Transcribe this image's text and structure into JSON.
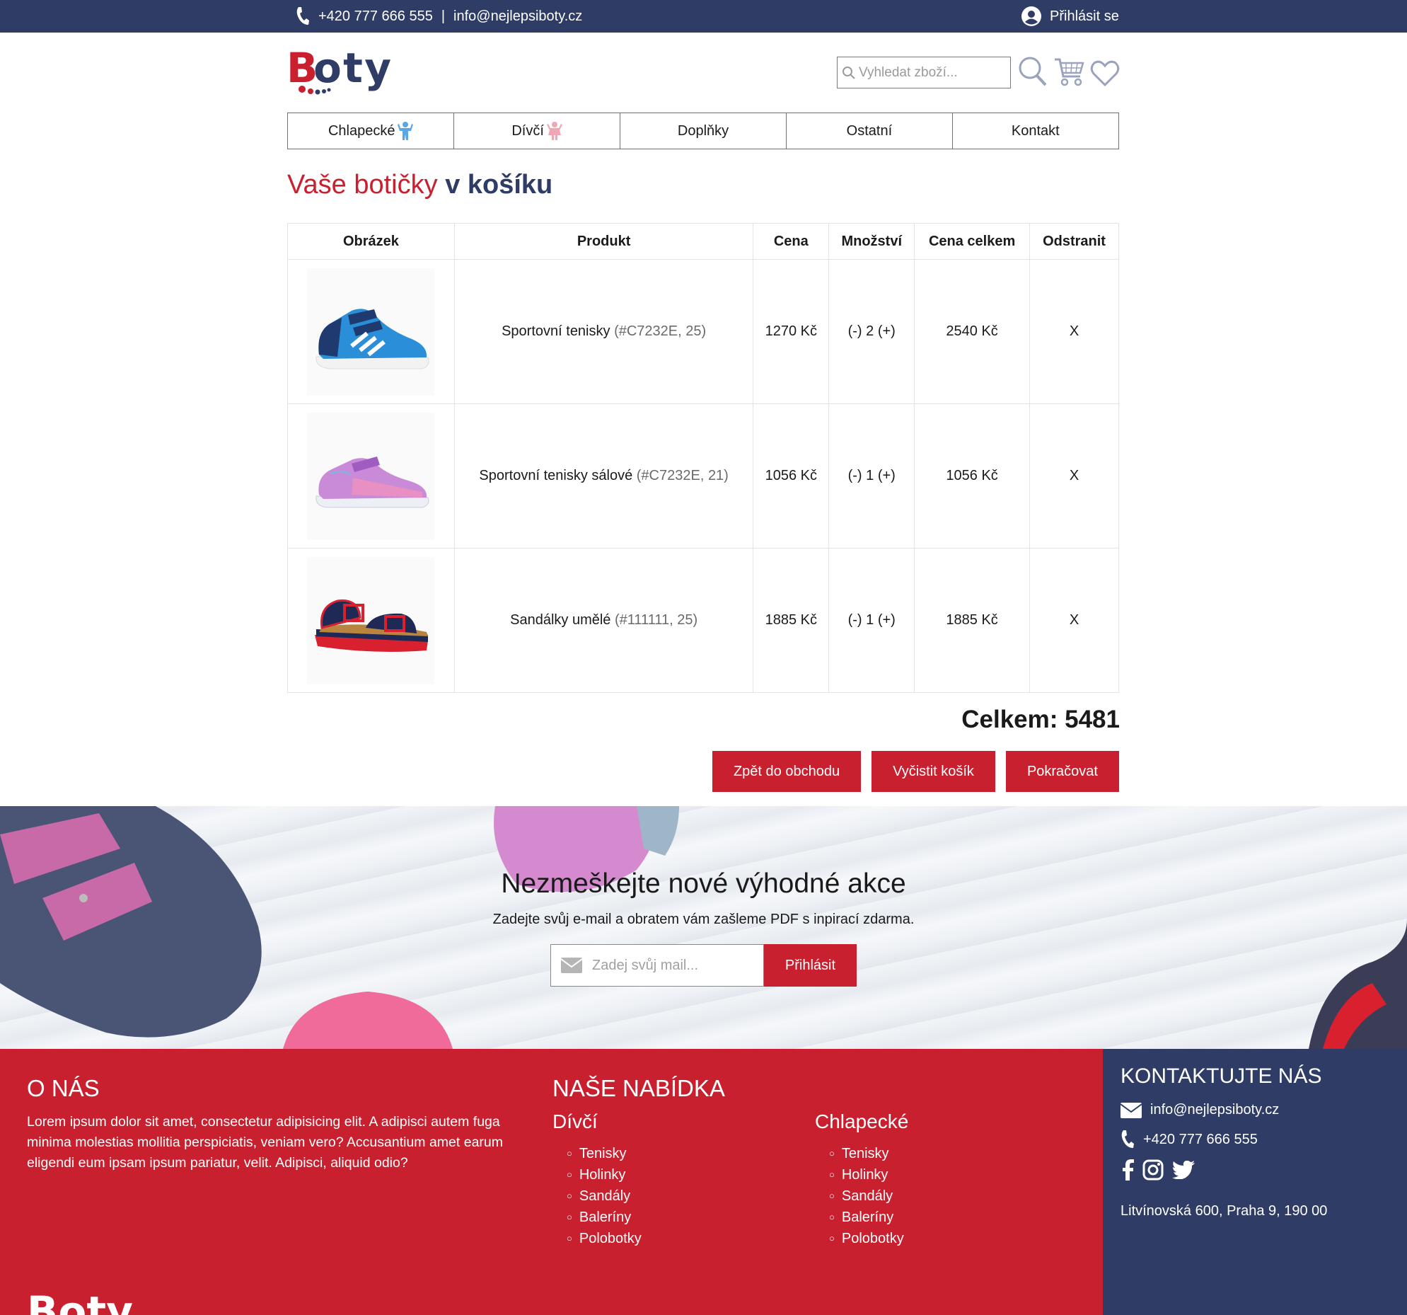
{
  "topbar": {
    "phone": "+420 777 666 555",
    "separator": "|",
    "email": "info@nejlepsiboty.cz",
    "login": "Přihlásit se"
  },
  "header": {
    "logo_text": "Boty",
    "search_placeholder": "Vyhledat zboží..."
  },
  "nav": [
    "Chlapecké",
    "Dívčí",
    "Doplňky",
    "Ostatní",
    "Kontakt"
  ],
  "title": {
    "part1": "Vaše botičky",
    "part2": "v košíku"
  },
  "cart": {
    "headers": [
      "Obrázek",
      "Produkt",
      "Cena",
      "Množství",
      "Cena celkem",
      "Odstranit"
    ],
    "rows": [
      {
        "name": "Sportovní tenisky",
        "code": "(#C7232E, 25)",
        "price": "1270 Kč",
        "qty": "(-) 2 (+)",
        "total": "2540 Kč",
        "remove": "X",
        "image": "blue-sneaker"
      },
      {
        "name": "Sportovní tenisky sálové",
        "code": "(#C7232E, 21)",
        "price": "1056 Kč",
        "qty": "(-) 1 (+)",
        "total": "1056 Kč",
        "remove": "X",
        "image": "pink-sneaker"
      },
      {
        "name": "Sandálky umělé",
        "code": "(#111111, 25)",
        "price": "1885 Kč",
        "qty": "(-) 1 (+)",
        "total": "1885 Kč",
        "remove": "X",
        "image": "navy-sandal"
      }
    ],
    "total_label": "Celkem: 5481",
    "buttons": {
      "back": "Zpět do obchodu",
      "clear": "Vyčistit košík",
      "continue": "Pokračovat"
    }
  },
  "newsletter": {
    "title": "Nezmeškejte nové výhodné akce",
    "subtitle": "Zadejte svůj e-mail a obratem vám zašleme PDF s inpirací zdarma.",
    "placeholder": "Zadej svůj mail...",
    "button": "Přihlásit"
  },
  "footer": {
    "about": {
      "heading": "O NÁS",
      "text": "Lorem ipsum dolor sit amet, consectetur adipisicing elit. A adipisci autem fuga minima molestias mollitia perspiciatis, veniam vero? Accusantium amet earum eligendi eum ipsam ipsum pariatur, velit. Adipisci, aliquid odio?"
    },
    "offer": {
      "heading": "NAŠE NABÍDKA",
      "girls": {
        "title": "Dívčí",
        "items": [
          "Tenisky",
          "Holinky",
          "Sandály",
          "Baleríny",
          "Polobotky"
        ]
      },
      "boys": {
        "title": "Chlapecké",
        "items": [
          "Tenisky",
          "Holinky",
          "Sandály",
          "Baleríny",
          "Polobotky"
        ]
      }
    },
    "contact": {
      "heading": "KONTAKTUJTE NÁS",
      "email": "info@nejlepsiboty.cz",
      "phone": "+420 777 666 555",
      "address": "Litvínovská 600, Praha 9, 190 00"
    },
    "logo_text": "Boty"
  },
  "colors": {
    "brand_red": "#c8202f",
    "brand_navy": "#2f3d66"
  }
}
